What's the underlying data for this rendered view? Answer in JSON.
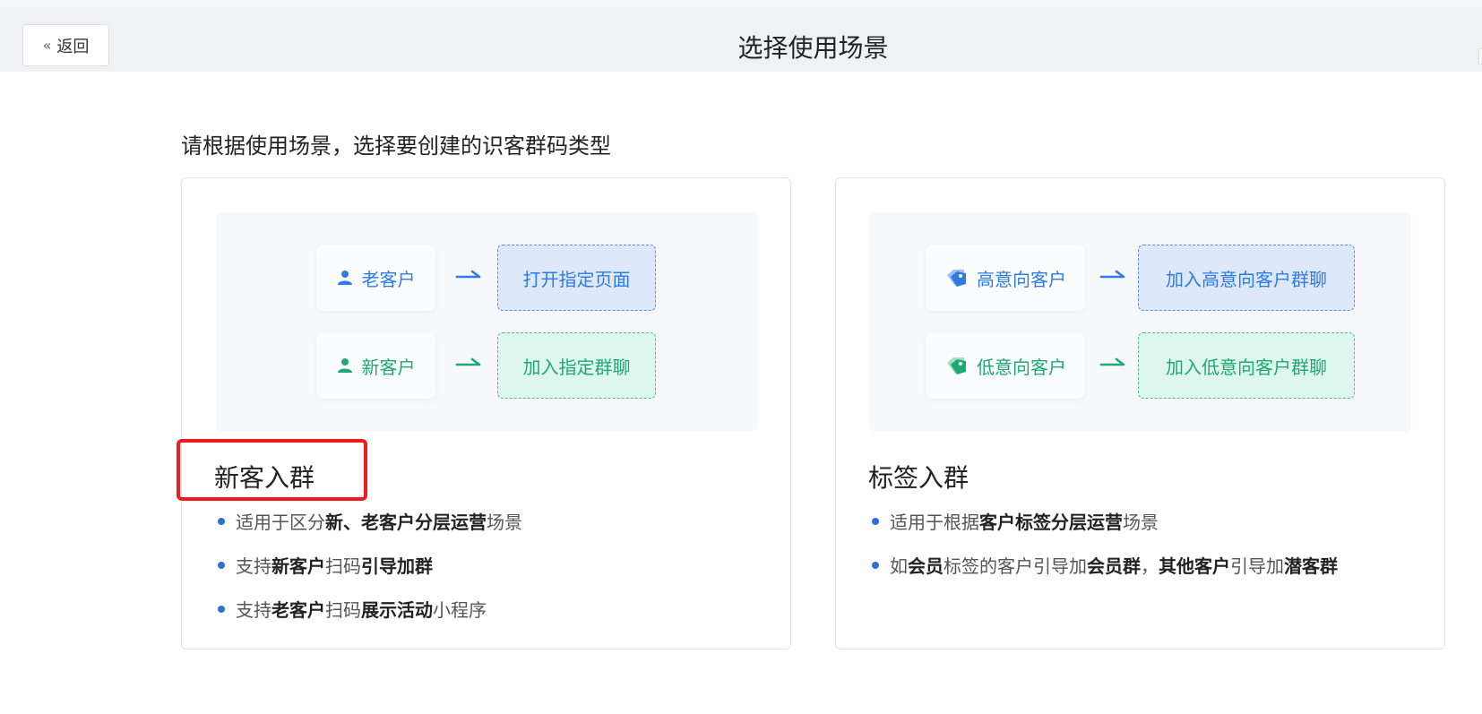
{
  "header": {
    "back_label": "返回",
    "title": "选择使用场景"
  },
  "subtitle": "请根据使用场景，选择要创建的识客群码类型",
  "cards": [
    {
      "title": "新客入群",
      "illustration": {
        "rows": [
          {
            "source": "老客户",
            "target": "打开指定页面",
            "color": "#2f7be6"
          },
          {
            "source": "新客户",
            "target": "加入指定群聊",
            "color": "#1fa874"
          }
        ]
      },
      "bullets": [
        [
          {
            "t": "适用于区分"
          },
          {
            "t": "新、老客户分层运营",
            "b": true
          },
          {
            "t": "场景"
          }
        ],
        [
          {
            "t": "支持"
          },
          {
            "t": "新客户",
            "b": true
          },
          {
            "t": "扫码"
          },
          {
            "t": "引导加群",
            "b": true
          }
        ],
        [
          {
            "t": "支持"
          },
          {
            "t": "老客户",
            "b": true
          },
          {
            "t": "扫码"
          },
          {
            "t": "展示活动",
            "b": true
          },
          {
            "t": "小程序"
          }
        ]
      ]
    },
    {
      "title": "标签入群",
      "illustration": {
        "rows": [
          {
            "source": "高意向客户",
            "target": "加入高意向客户群聊",
            "color": "#2f7be6"
          },
          {
            "source": "低意向客户",
            "target": "加入低意向客户群聊",
            "color": "#1fa874"
          }
        ]
      },
      "bullets": [
        [
          {
            "t": "适用于根据"
          },
          {
            "t": "客户标签分层运营",
            "b": true
          },
          {
            "t": "场景"
          }
        ],
        [
          {
            "t": "如"
          },
          {
            "t": "会员",
            "b": true
          },
          {
            "t": "标签的客户引导加"
          },
          {
            "t": "会员群",
            "b": true
          },
          {
            "t": "，"
          },
          {
            "t": "其他客户",
            "b": true
          },
          {
            "t": "引导加"
          },
          {
            "t": "潜客群",
            "b": true
          }
        ]
      ]
    }
  ]
}
